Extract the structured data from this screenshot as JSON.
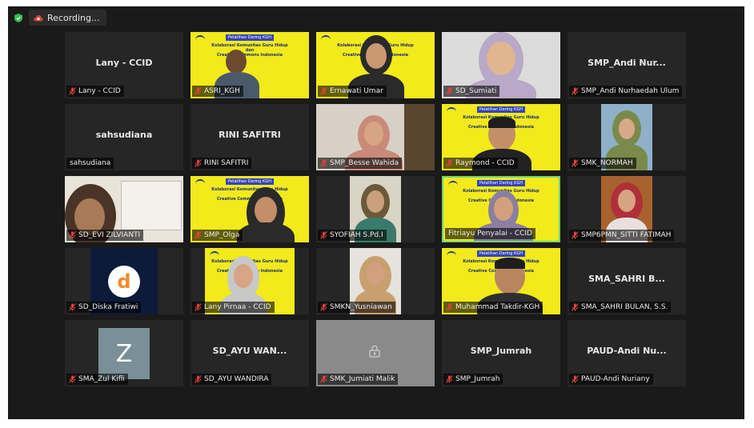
{
  "recording": {
    "label": "Recording..."
  },
  "colors": {
    "accent_green": "#6fd46f",
    "slide_yellow": "#f2ea1a",
    "mic_red": "#e0413a"
  },
  "slide": {
    "header": "Pelatihan Daring KGH",
    "line1": "Kolaborasi Komunitas Guru Hidup",
    "line2": "dan",
    "line3": "Creative Commons Indonesia"
  },
  "tiles": [
    {
      "name": "Lany - CCID",
      "center": "Lany - CCID",
      "muted": true
    },
    {
      "name": "ASRI_KGH",
      "muted": true
    },
    {
      "name": "Ernawati Umar",
      "muted": true
    },
    {
      "name": "SD_Sumiati",
      "muted": true
    },
    {
      "name": "SMP_Andi Nurhaedah Ulum",
      "center": "SMP_Andi Nur...",
      "muted": true
    },
    {
      "name": "sahsudiana",
      "center": "sahsudiana",
      "muted": false
    },
    {
      "name": "RINI SAFITRI",
      "center": "RINI SAFITRI",
      "muted": true
    },
    {
      "name": "SMP_Besse Wahida",
      "muted": true
    },
    {
      "name": "Raymond - CCID",
      "muted": true
    },
    {
      "name": "SMK_NORMAH",
      "muted": true
    },
    {
      "name": "SD_EVI ZILVIANTI",
      "muted": true
    },
    {
      "name": "SMP_Olga",
      "muted": true
    },
    {
      "name": "SYOFIAH S.Pd.I",
      "muted": true
    },
    {
      "name": "Fitriayu Penyalai - CCID",
      "muted": false,
      "active": true
    },
    {
      "name": "SMP6PMN_SITTI FATIMAH",
      "muted": true
    },
    {
      "name": "SD_Diska Fratiwi",
      "avatar_letter": "d",
      "muted": true
    },
    {
      "name": "Lany Pirnaa - CCID",
      "muted": true
    },
    {
      "name": "SMKN_Yusniawan",
      "muted": true
    },
    {
      "name": "Muhammad Takdir-KGH",
      "muted": true
    },
    {
      "name": "SMA_SAHRI BULAN, S.S.",
      "center": "SMA_SAHRI B...",
      "muted": true
    },
    {
      "name": "SMA_Zul Kifli",
      "avatar_letter": "Z",
      "muted": true
    },
    {
      "name": "SD_AYU WANDIRA",
      "center": "SD_AYU WAN...",
      "muted": true
    },
    {
      "name": "SMK_Jumiati Malik",
      "muted": true
    },
    {
      "name": "SMP_Jumrah",
      "center": "SMP_Jumrah",
      "muted": true
    },
    {
      "name": "PAUD-Andi Nuriany",
      "center": "PAUD-Andi Nu...",
      "muted": true
    }
  ]
}
